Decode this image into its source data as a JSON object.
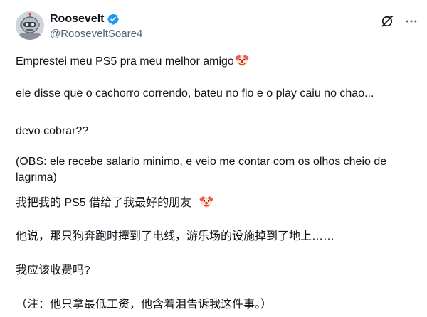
{
  "author": {
    "display_name": "Roosevelt",
    "handle": "@RooseveltSoare4",
    "verified_icon": "verified-badge-icon",
    "avatar_icon": "robot-avatar"
  },
  "header_actions": {
    "grok_icon": "grok-icon",
    "more_icon": "more-horizontal-icon"
  },
  "post": {
    "pt_line1": "Emprestei meu PS5 pra meu melhor amigo",
    "pt_line2": "ele disse que o cachorro correndo, bateu no fio e o play caiu no chao...",
    "pt_line3": "devo cobrar??",
    "pt_line4a": "(OBS: ele recebe salario minimo, e veio me contar com os olhos cheio de",
    "pt_line4b": "lagrima)",
    "zh_line1": "我把我的 PS5 借给了我最好的朋友",
    "zh_line2": "他说，那只狗奔跑时撞到了电线，游乐场的设施掉到了地上……",
    "zh_line3": "我应该收费吗?",
    "zh_line4": "（注：他只拿最低工资，他含着泪告诉我这件事。）",
    "emoji": "clown-face-emoji"
  },
  "colors": {
    "text": "#0f1419",
    "secondary": "#536471",
    "verified": "#1d9bf0"
  }
}
